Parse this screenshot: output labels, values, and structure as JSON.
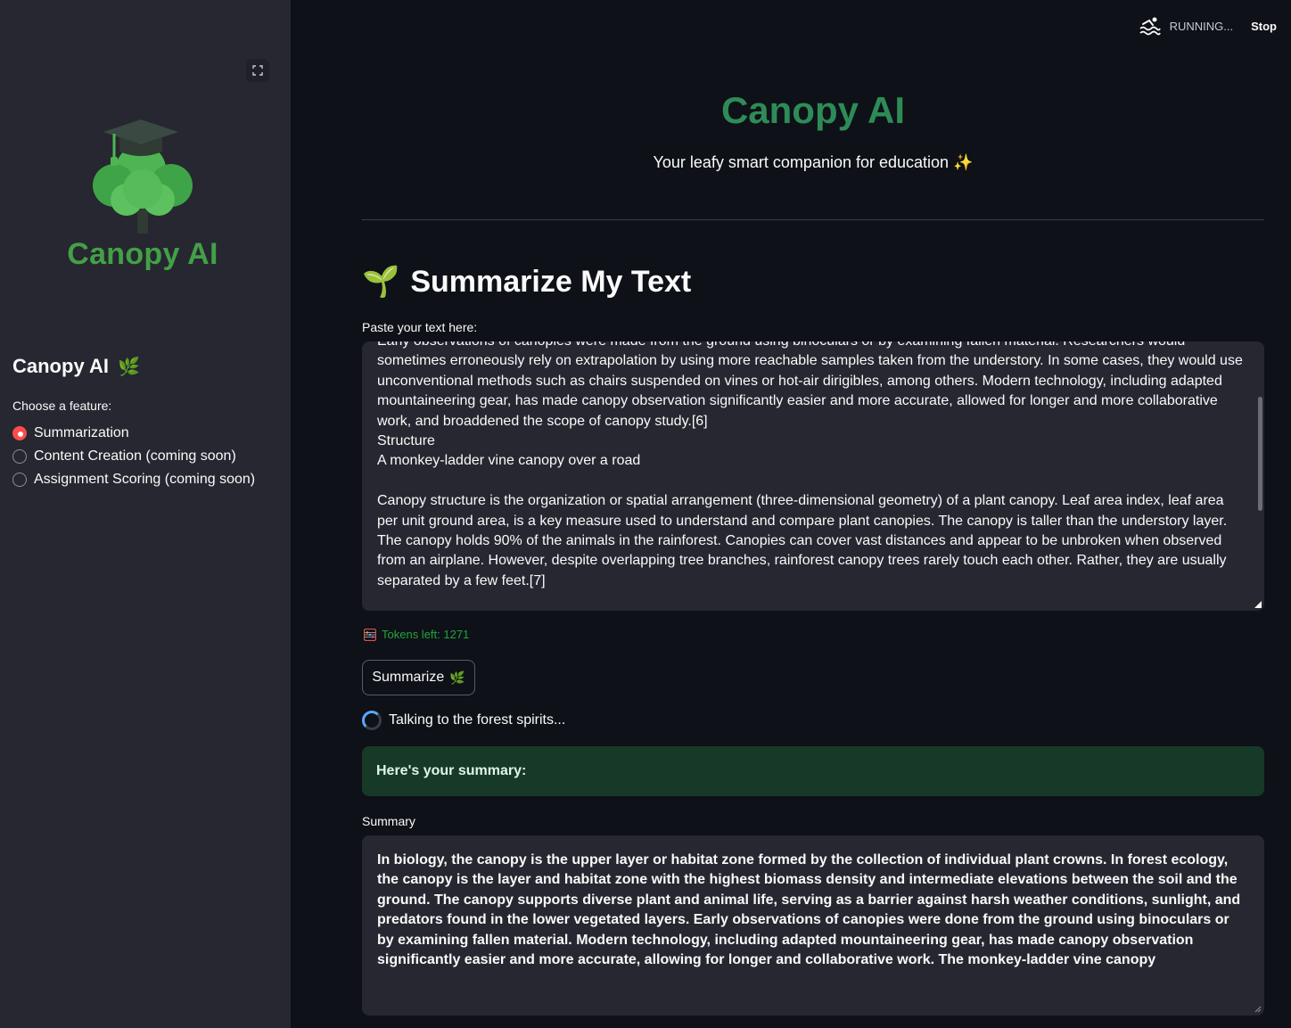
{
  "status": {
    "running_label": "RUNNING...",
    "stop_label": "Stop"
  },
  "sidebar": {
    "logo_text": "Canopy AI",
    "title": "Canopy AI",
    "title_emoji": "🌿",
    "choose_label": "Choose a feature:",
    "options": [
      {
        "label": "Summarization",
        "selected": true
      },
      {
        "label": "Content Creation (coming soon)",
        "selected": false
      },
      {
        "label": "Assignment Scoring (coming soon)",
        "selected": false
      }
    ]
  },
  "main": {
    "title": "Canopy AI",
    "subtitle": "Your leafy smart companion for education ✨",
    "section_emoji": "🌱",
    "section_title": "Summarize My Text",
    "input_label": "Paste your text here:",
    "input_text": "Early observations of canopies were made from the ground using binoculars or by examining fallen material. Researchers would sometimes erroneously rely on extrapolation by using more reachable samples taken from the understory. In some cases, they would use unconventional methods such as chairs suspended on vines or hot-air dirigibles, among others. Modern technology, including adapted mountaineering gear, has made canopy observation significantly easier and more accurate, allowed for longer and more collaborative work, and broaddened the scope of canopy study.[6]\nStructure\nA monkey-ladder vine canopy over a road\n\nCanopy structure is the organization or spatial arrangement (three-dimensional geometry) of a plant canopy. Leaf area index, leaf area per unit ground area, is a key measure used to understand and compare plant canopies. The canopy is taller than the understory layer. The canopy holds 90% of the animals in the rainforest. Canopies can cover vast distances and appear to be unbroken when observed from an airplane. However, despite overlapping tree branches, rainforest canopy trees rarely touch each other. Rather, they are usually separated by a few feet.[7]\n\nDominant and co-dominant canopy trees form the uneven canopy layer. Canopy trees are able to photosynthesize relatively rapidly with abundant",
    "tokens_label": "Tokens left: 1271",
    "summarize_button": "Summarize",
    "summarize_emoji": "🌿",
    "spinner_text": "Talking to the forest spirits...",
    "success_text": "Here's your summary:",
    "summary_label": "Summary",
    "summary_text": "In biology, the canopy is the upper layer or habitat zone formed by the collection of individual plant crowns. In forest ecology, the canopy is the layer and habitat zone with the highest biomass density and intermediate elevations between the soil and the ground. The canopy supports diverse plant and animal life, serving as a barrier against harsh weather conditions, sunlight, and predators found in the lower vegetated layers. Early observations of canopies were done from the ground using binoculars or by examining fallen material. Modern technology, including adapted mountaineering gear, has made canopy observation significantly easier and more accurate, allowing for longer and collaborative work. The monkey-ladder vine canopy"
  },
  "colors": {
    "accent_red": "#ff4b4b",
    "brand_green": "#2e8b57",
    "success_bg": "#173928"
  }
}
